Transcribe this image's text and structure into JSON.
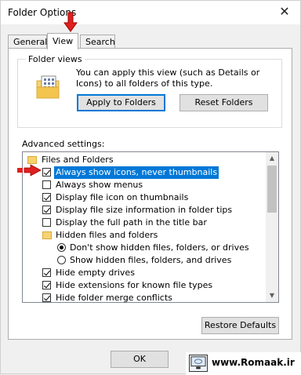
{
  "window": {
    "title": "Folder Options"
  },
  "tabs": [
    {
      "label": "General"
    },
    {
      "label": "View"
    },
    {
      "label": "Search"
    }
  ],
  "folder_views": {
    "title": "Folder views",
    "description": "You can apply this view (such as Details or Icons) to all folders of this type.",
    "apply_button": "Apply to Folders",
    "reset_button": "Reset Folders"
  },
  "advanced": {
    "label": "Advanced settings:",
    "items": [
      {
        "kind": "folder",
        "label": "Files and Folders"
      },
      {
        "kind": "checkbox",
        "label": "Always show icons, never thumbnails",
        "checked": true,
        "selected": true
      },
      {
        "kind": "checkbox",
        "label": "Always show menus",
        "checked": false
      },
      {
        "kind": "checkbox",
        "label": "Display file icon on thumbnails",
        "checked": true
      },
      {
        "kind": "checkbox",
        "label": "Display file size information in folder tips",
        "checked": true
      },
      {
        "kind": "checkbox",
        "label": "Display the full path in the title bar",
        "checked": false
      },
      {
        "kind": "folder",
        "label": "Hidden files and folders"
      },
      {
        "kind": "radio",
        "label": "Don't show hidden files, folders, or drives",
        "checked": true
      },
      {
        "kind": "radio",
        "label": "Show hidden files, folders, and drives",
        "checked": false
      },
      {
        "kind": "checkbox",
        "label": "Hide empty drives",
        "checked": true
      },
      {
        "kind": "checkbox",
        "label": "Hide extensions for known file types",
        "checked": true
      },
      {
        "kind": "checkbox",
        "label": "Hide folder merge conflicts",
        "checked": true
      }
    ],
    "restore_button": "Restore Defaults"
  },
  "footer": {
    "ok_button": "OK"
  },
  "watermark": {
    "text": "www.Romaak.ir"
  },
  "colors": {
    "accent": "#0078d7",
    "arrow": "#e02020"
  }
}
